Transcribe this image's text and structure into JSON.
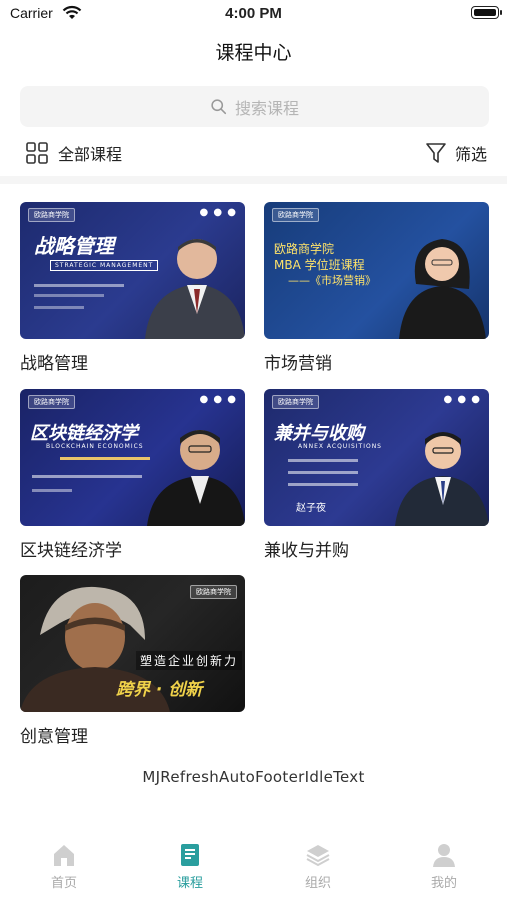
{
  "status_bar": {
    "carrier": "Carrier",
    "time": "4:00 PM"
  },
  "nav": {
    "title": "课程中心"
  },
  "search": {
    "placeholder": "搜索课程"
  },
  "filters": {
    "all_label": "全部课程",
    "filter_label": "筛选"
  },
  "courses": [
    {
      "name": "战略管理",
      "thumb_title": "战略管理",
      "thumb_subtitle": "STRATEGIC MANAGEMENT"
    },
    {
      "name": "市场营销",
      "thumb_title": "欧路商学院",
      "thumb_line2": "MBA 学位班课程",
      "thumb_line3": "——《市场营销》"
    },
    {
      "name": "区块链经济学",
      "thumb_title": "区块链经济学",
      "thumb_subtitle": "BLOCKCHAIN ECONOMICS"
    },
    {
      "name": "兼收与并购",
      "thumb_title": "兼并与收购",
      "thumb_subtitle": "ANNEX ACQUISITIONS",
      "thumb_speaker": "赵子夜"
    },
    {
      "name": "创意管理",
      "thumb_title": "跨界 · 创新",
      "thumb_subtitle": "塑造企业创新力"
    }
  ],
  "footer": {
    "text": "MJRefreshAutoFooterIdleText"
  },
  "tabs": [
    {
      "label": "首页",
      "active": false
    },
    {
      "label": "课程",
      "active": true
    },
    {
      "label": "组织",
      "active": false
    },
    {
      "label": "我的",
      "active": false
    }
  ],
  "colors": {
    "accent": "#2a9e9e",
    "tab_inactive": "#aaaaaa",
    "search_bg": "#f4f4f4"
  }
}
